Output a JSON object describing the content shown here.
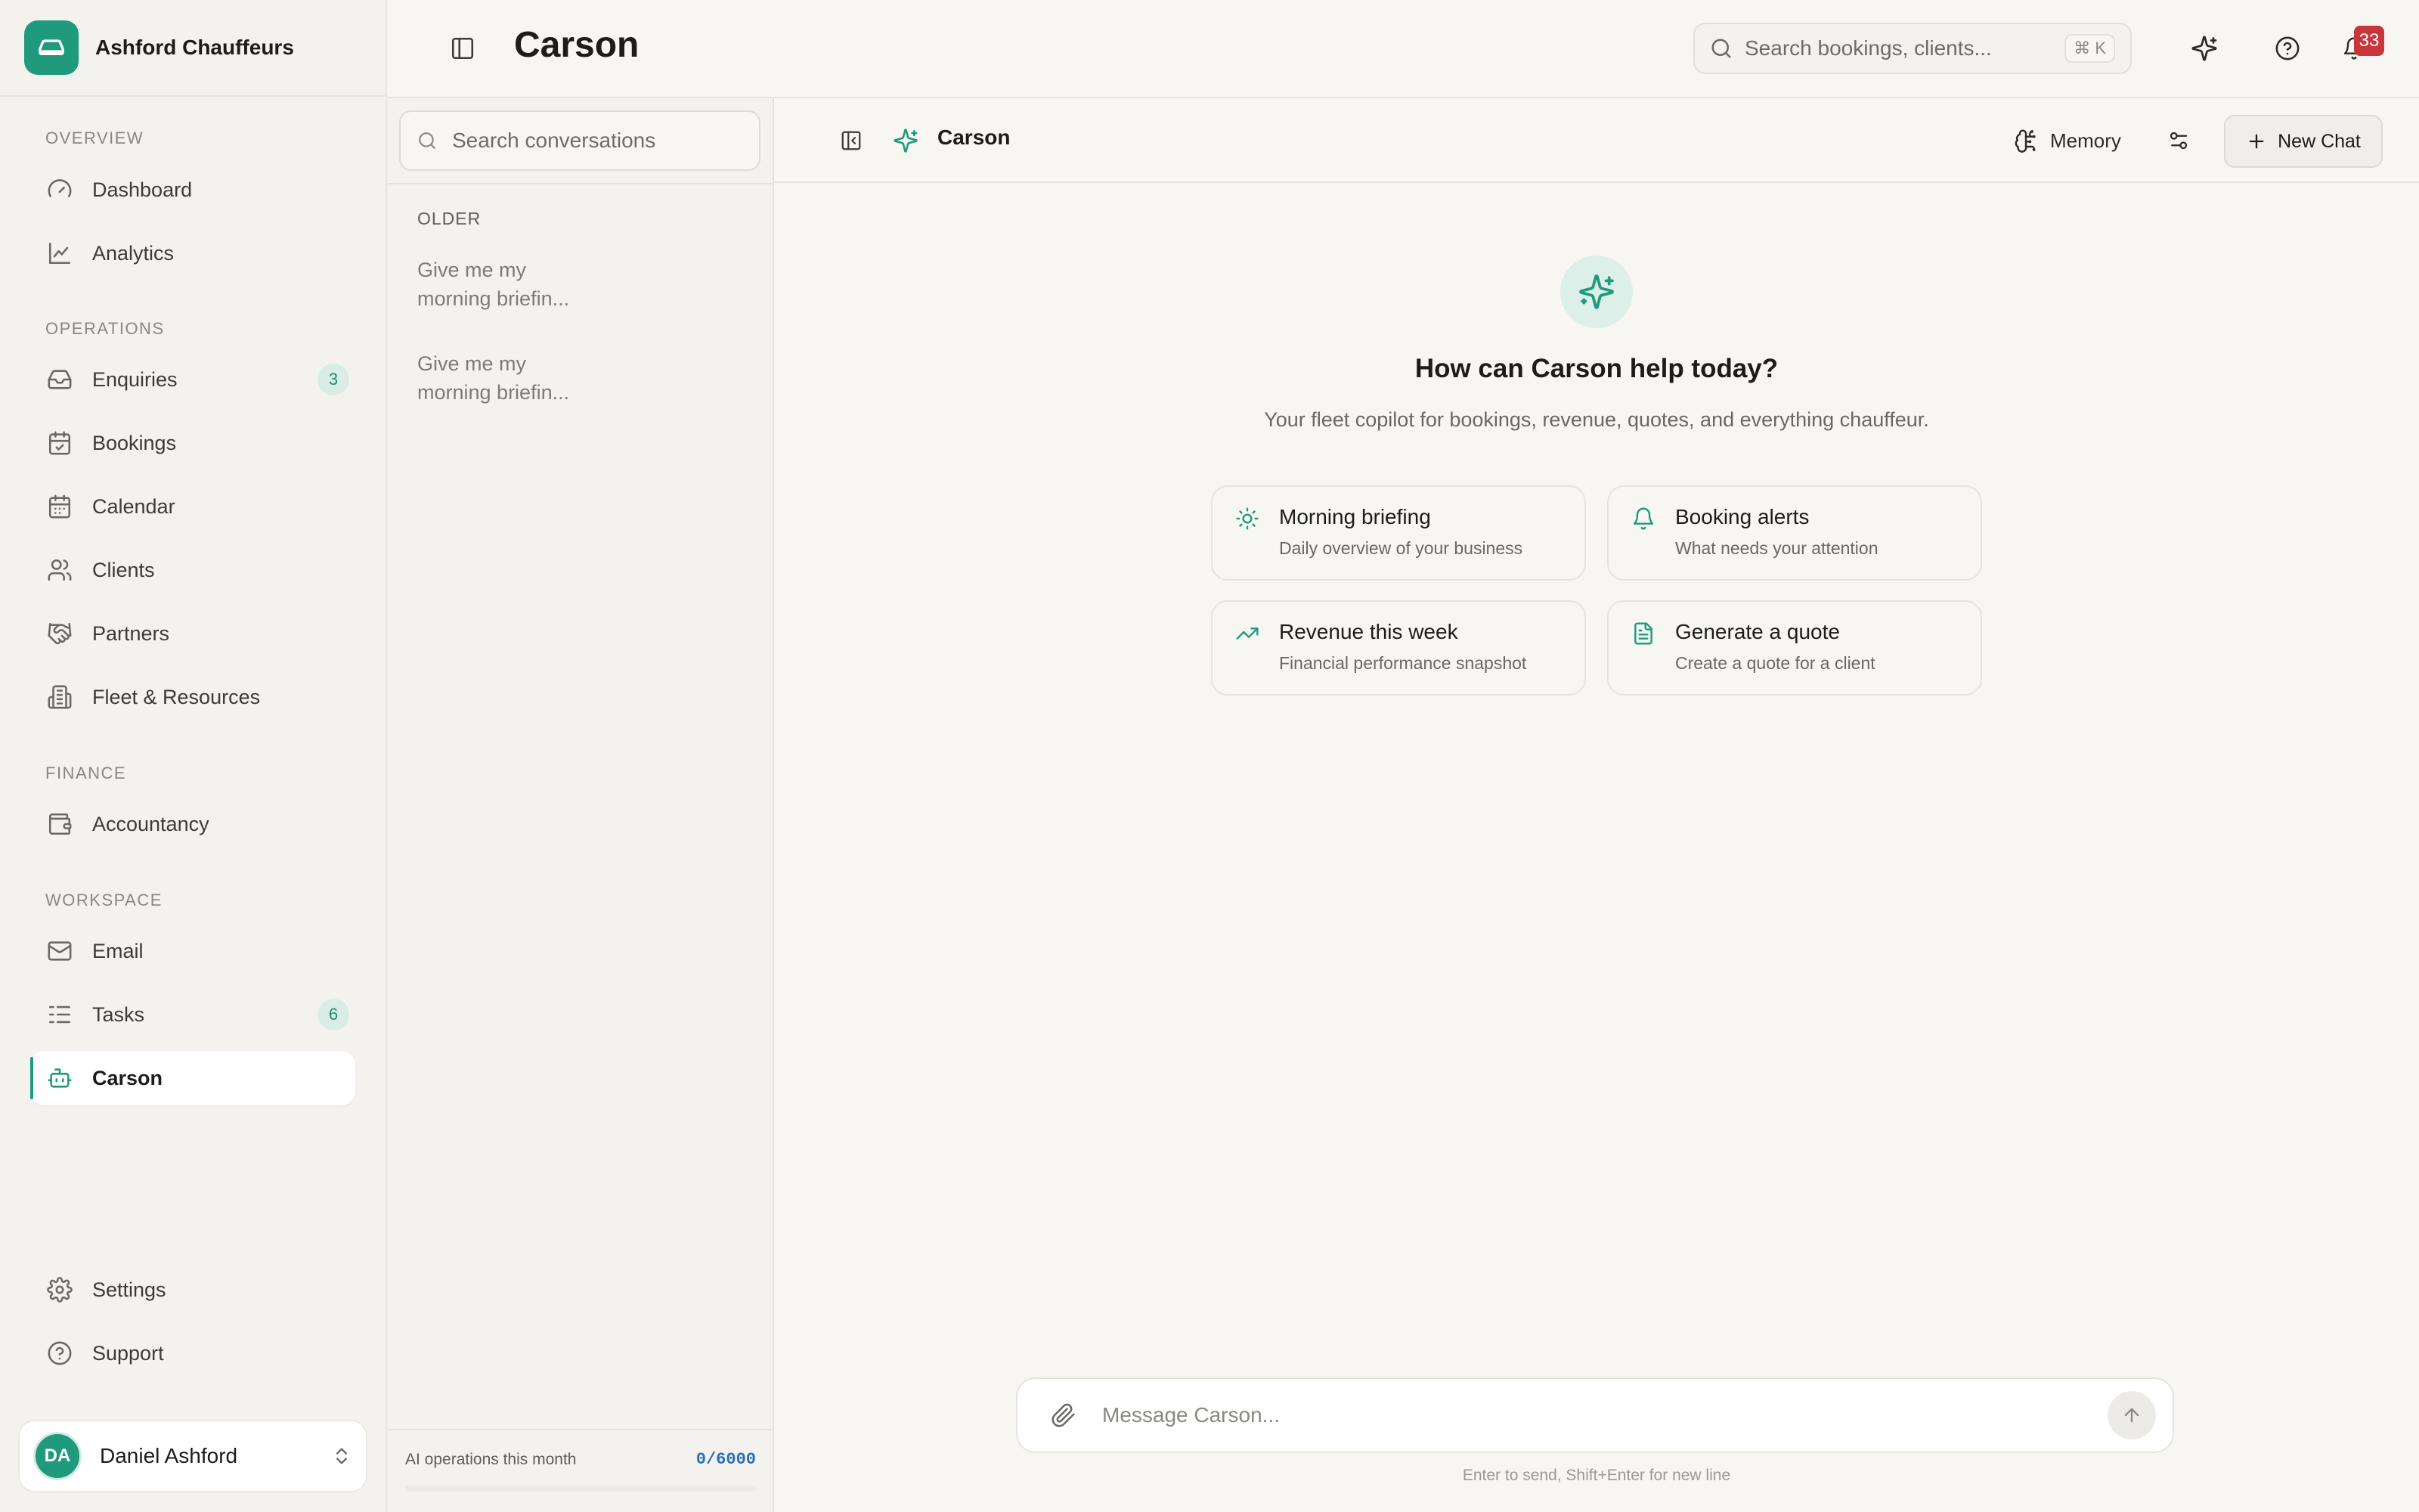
{
  "brand": {
    "name": "Ashford Chauffeurs",
    "logo_icon": "car-icon",
    "accent": "#1f9a7c"
  },
  "sidebar": {
    "sections": [
      {
        "title": "OVERVIEW",
        "items": [
          {
            "label": "Dashboard",
            "icon": "gauge-icon"
          },
          {
            "label": "Analytics",
            "icon": "line-chart-icon"
          }
        ]
      },
      {
        "title": "OPERATIONS",
        "items": [
          {
            "label": "Enquiries",
            "icon": "inbox-icon",
            "badge": "3"
          },
          {
            "label": "Bookings",
            "icon": "calendar-check-icon"
          },
          {
            "label": "Calendar",
            "icon": "calendar-icon"
          },
          {
            "label": "Clients",
            "icon": "users-icon"
          },
          {
            "label": "Partners",
            "icon": "handshake-icon"
          },
          {
            "label": "Fleet & Resources",
            "icon": "building-icon"
          }
        ]
      },
      {
        "title": "FINANCE",
        "items": [
          {
            "label": "Accountancy",
            "icon": "wallet-icon"
          }
        ]
      },
      {
        "title": "WORKSPACE",
        "items": [
          {
            "label": "Email",
            "icon": "mail-icon"
          },
          {
            "label": "Tasks",
            "icon": "list-checks-icon",
            "badge": "6"
          },
          {
            "label": "Carson",
            "icon": "bot-icon",
            "active": true
          }
        ]
      }
    ],
    "footer": [
      {
        "label": "Settings",
        "icon": "gear-icon"
      },
      {
        "label": "Support",
        "icon": "help-circle-icon"
      }
    ],
    "user": {
      "initials": "DA",
      "name": "Daniel Ashford"
    }
  },
  "header": {
    "title": "Carson",
    "search": {
      "placeholder": "Search bookings, clients...",
      "shortcut": "⌘ K"
    },
    "notifications_count": "33"
  },
  "conversations": {
    "search_placeholder": "Search conversations",
    "group_title": "OLDER",
    "items": [
      {
        "title": "Give me my morning briefin..."
      },
      {
        "title": "Give me my morning briefin..."
      }
    ],
    "usage": {
      "label": "AI operations this month",
      "value": "0/6000",
      "used": 0,
      "limit": 6000
    }
  },
  "chat": {
    "assistant_name": "Carson",
    "memory_label": "Memory",
    "new_chat_label": "New Chat",
    "hero_title": "How can Carson help today?",
    "hero_subtitle": "Your fleet copilot for bookings, revenue, quotes, and everything chauffeur.",
    "suggestions": [
      {
        "title": "Morning briefing",
        "desc": "Daily overview of your business",
        "icon": "sun-icon"
      },
      {
        "title": "Booking alerts",
        "desc": "What needs your attention",
        "icon": "bell-icon"
      },
      {
        "title": "Revenue this week",
        "desc": "Financial performance snapshot",
        "icon": "trending-up-icon"
      },
      {
        "title": "Generate a quote",
        "desc": "Create a quote for a client",
        "icon": "file-text-icon"
      }
    ],
    "composer_placeholder": "Message Carson...",
    "composer_hint": "Enter to send, Shift+Enter for new line"
  }
}
